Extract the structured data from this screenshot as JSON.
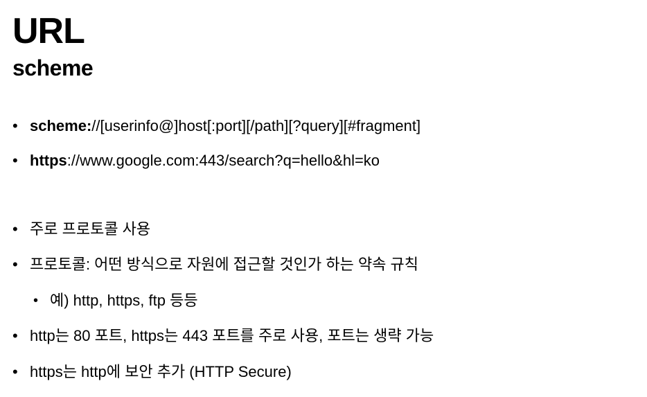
{
  "title": "URL",
  "subtitle": "scheme",
  "bullets": {
    "syntax": {
      "bold": "scheme:",
      "rest": "//[userinfo@]host[:port][/path][?query][#fragment]"
    },
    "example": {
      "bold": "https",
      "rest": "://www.google.com:443/search?q=hello&hl=ko"
    },
    "protocol_use": "주로 프로토콜 사용",
    "protocol_def": "프로토콜: 어떤 방식으로 자원에 접근할 것인가 하는 약속 규칙",
    "protocol_examples": "예) http, https, ftp 등등",
    "ports": "http는 80 포트, https는 443 포트를 주로 사용, 포트는 생략 가능",
    "https_secure": "https는 http에 보안 추가 (HTTP Secure)"
  },
  "bullet_glyph": "•"
}
